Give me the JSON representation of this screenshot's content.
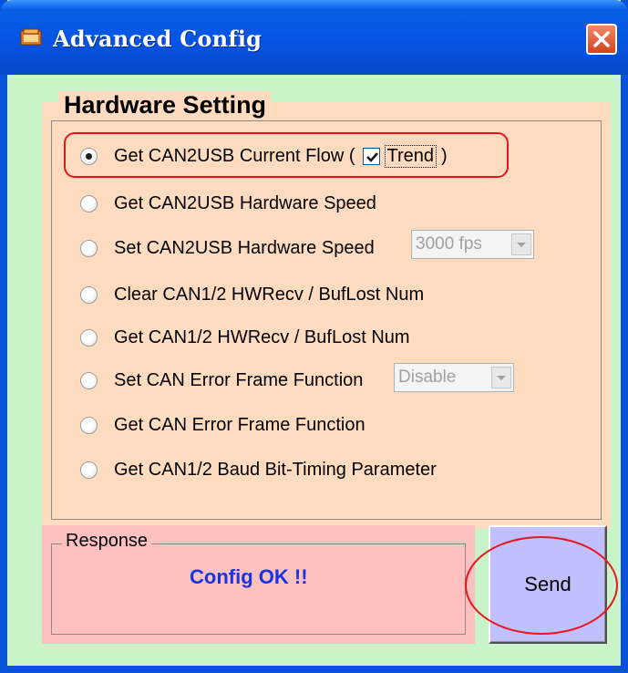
{
  "window": {
    "title": "Advanced Config"
  },
  "hardware": {
    "group_title": "Hardware Setting",
    "options": [
      {
        "label": "Get CAN2USB Current Flow  (",
        "selected": true
      },
      {
        "label": "Get CAN2USB Hardware Speed",
        "selected": false
      },
      {
        "label": "Set CAN2USB Hardware Speed",
        "selected": false
      },
      {
        "label": "Clear CAN1/2 HWRecv / BufLost Num",
        "selected": false
      },
      {
        "label": "Get CAN1/2 HWRecv / BufLost Num",
        "selected": false
      },
      {
        "label": "Set CAN Error Frame Function",
        "selected": false
      },
      {
        "label": "Get CAN Error Frame Function",
        "selected": false
      },
      {
        "label": "Get CAN1/2 Baud Bit-Timing Parameter",
        "selected": false
      }
    ],
    "trend": {
      "label": "Trend",
      "checked": true,
      "close_paren": ")"
    },
    "speed_select": {
      "value": "3000 fps"
    },
    "error_frame_select": {
      "value": "Disable"
    }
  },
  "response": {
    "group_title": "Response",
    "message": "Config OK !!"
  },
  "send_button": {
    "label": "Send"
  },
  "colors": {
    "titlebar": "#0554e3",
    "client_bg": "#c9f3c9",
    "hw_bg": "#ffdcc0",
    "resp_bg": "#ffc0c0",
    "send_bg": "#c0c0ff",
    "highlight": "#e8141e",
    "message": "#1535e6"
  }
}
